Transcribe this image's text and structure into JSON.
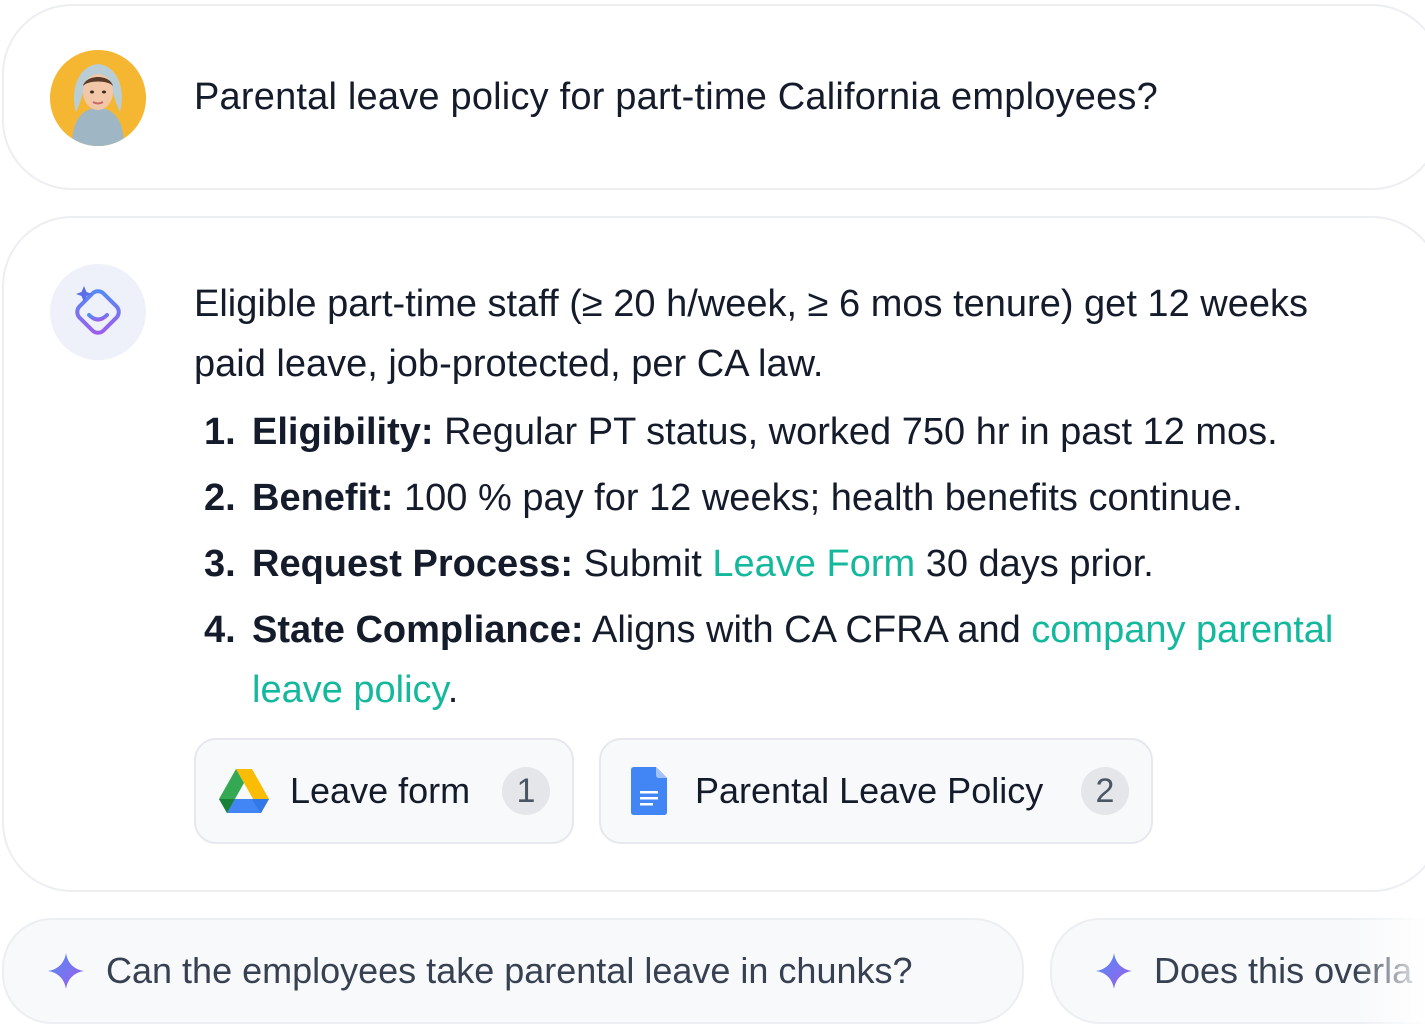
{
  "question": {
    "text": "Parental leave policy for part-time California employees?"
  },
  "answer": {
    "summary": "Eligible part-time staff (≥ 20 h/week, ≥ 6 mos tenure) get 12 weeks paid leave, job-protected, per CA law.",
    "items": [
      {
        "number": "1.",
        "label": "Eligibility:",
        "text": " Regular PT status, worked 750 hr in past 12 mos."
      },
      {
        "number": "2.",
        "label": "Benefit:",
        "text": " 100 % pay for 12 weeks; health benefits continue."
      },
      {
        "number": "3.",
        "label": "Request Process:",
        "text_before": " Submit ",
        "link": "Leave Form",
        "text_after": " 30 days prior."
      },
      {
        "number": "4.",
        "label": "State Compliance:",
        "text_before": " Aligns with CA CFRA and ",
        "link": "company parental leave policy",
        "text_after": "."
      }
    ],
    "sources": [
      {
        "label": "Leave form",
        "count": "1",
        "icon": "google-drive-icon"
      },
      {
        "label": "Parental Leave Policy",
        "count": "2",
        "icon": "google-docs-icon"
      }
    ]
  },
  "suggestions": [
    {
      "text": "Can the employees take parental leave in chunks?",
      "icon": "sparkle-icon"
    },
    {
      "text": "Does this overla",
      "icon": "sparkle-icon"
    }
  ],
  "colors": {
    "link": "#14b89c",
    "text": "#141b2b",
    "chip_bg": "#f8f9fb",
    "user_avatar_bg": "#f5b731"
  }
}
